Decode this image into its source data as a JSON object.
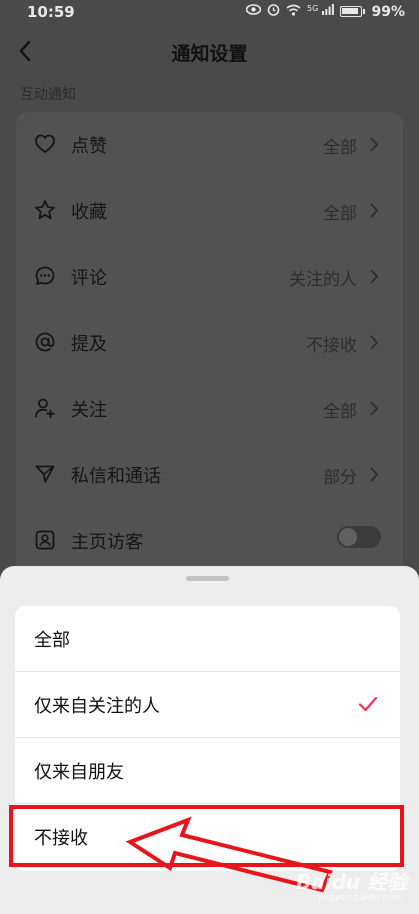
{
  "status_bar": {
    "time": "10:59",
    "network": "5G",
    "battery": "99%"
  },
  "header": {
    "title": "通知设置"
  },
  "section": {
    "label": "互动通知"
  },
  "settings": [
    {
      "icon": "heart-icon",
      "label": "点赞",
      "value": "全部"
    },
    {
      "icon": "star-icon",
      "label": "收藏",
      "value": "全部"
    },
    {
      "icon": "comment-icon",
      "label": "评论",
      "value": "关注的人"
    },
    {
      "icon": "at-icon",
      "label": "提及",
      "value": "不接收"
    },
    {
      "icon": "user-add-icon",
      "label": "关注",
      "value": "全部"
    },
    {
      "icon": "send-icon",
      "label": "私信和通话",
      "value": "部分"
    },
    {
      "icon": "profile-icon",
      "label": "主页访客",
      "toggle": false
    }
  ],
  "sheet": {
    "options": [
      {
        "label": "全部",
        "selected": false
      },
      {
        "label": "仅来自关注的人",
        "selected": true
      },
      {
        "label": "仅来自朋友",
        "selected": false
      },
      {
        "label": "不接收",
        "selected": false
      }
    ]
  },
  "annotation": {
    "highlight_color": "#e8141c",
    "highlight_target": "不接收"
  },
  "watermark": {
    "text": "Baidu 经验",
    "sub": "jingyan.baidu.com"
  },
  "colors": {
    "accent_check": "#ff2c55",
    "overlay": "#4a4a4a",
    "sheet_bg": "#ededed"
  }
}
